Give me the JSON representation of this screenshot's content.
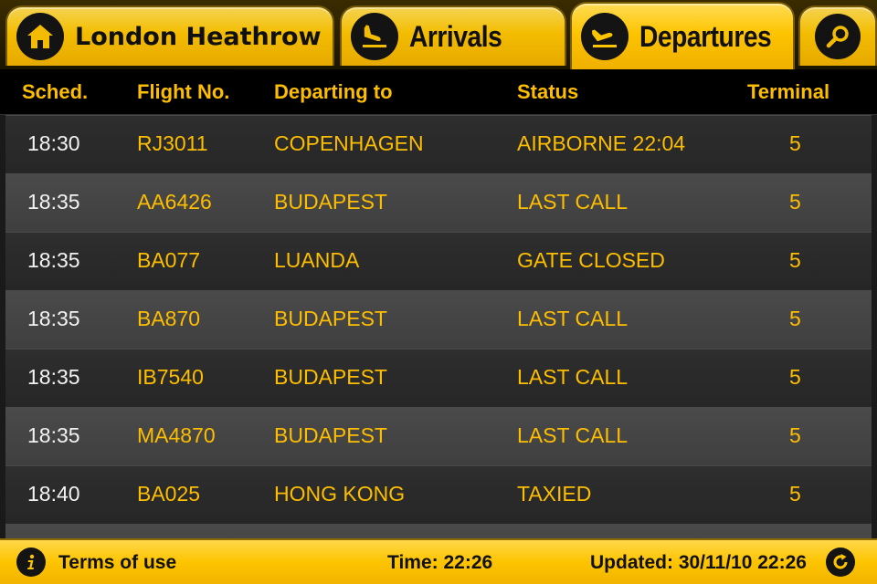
{
  "tabs": {
    "home": {
      "label": "London Heathrow",
      "icon": "home-icon"
    },
    "arrivals": {
      "label": "Arrivals",
      "icon": "plane-landing-icon"
    },
    "departures": {
      "label": "Departures",
      "icon": "plane-takeoff-icon",
      "active": true
    },
    "search": {
      "icon": "search-icon"
    }
  },
  "columns": [
    "Sched.",
    "Flight No.",
    "Departing to",
    "Status",
    "Terminal"
  ],
  "rows": [
    {
      "sched": "18:30",
      "flight": "RJ3011",
      "dest": "COPENHAGEN",
      "status": "AIRBORNE 22:04",
      "terminal": "5"
    },
    {
      "sched": "18:35",
      "flight": "AA6426",
      "dest": "BUDAPEST",
      "status": "LAST CALL",
      "terminal": "5"
    },
    {
      "sched": "18:35",
      "flight": "BA077",
      "dest": "LUANDA",
      "status": "GATE CLOSED",
      "terminal": "5"
    },
    {
      "sched": "18:35",
      "flight": "BA870",
      "dest": "BUDAPEST",
      "status": "LAST CALL",
      "terminal": "5"
    },
    {
      "sched": "18:35",
      "flight": "IB7540",
      "dest": "BUDAPEST",
      "status": "LAST CALL",
      "terminal": "5"
    },
    {
      "sched": "18:35",
      "flight": "MA4870",
      "dest": "BUDAPEST",
      "status": "LAST CALL",
      "terminal": "5"
    },
    {
      "sched": "18:40",
      "flight": "BA025",
      "dest": "HONG KONG",
      "status": "TAXIED",
      "terminal": "5"
    }
  ],
  "footer": {
    "terms_label": "Terms of use",
    "time_text": "Time: 22:26",
    "updated_text": "Updated: 30/11/10 22:26",
    "info_icon": "info-icon",
    "refresh_icon": "refresh-icon"
  },
  "colors": {
    "accent": "#fdc400",
    "text_accent": "#fdbe00",
    "row_dark": "#2a2a2a",
    "row_light": "#454545"
  }
}
